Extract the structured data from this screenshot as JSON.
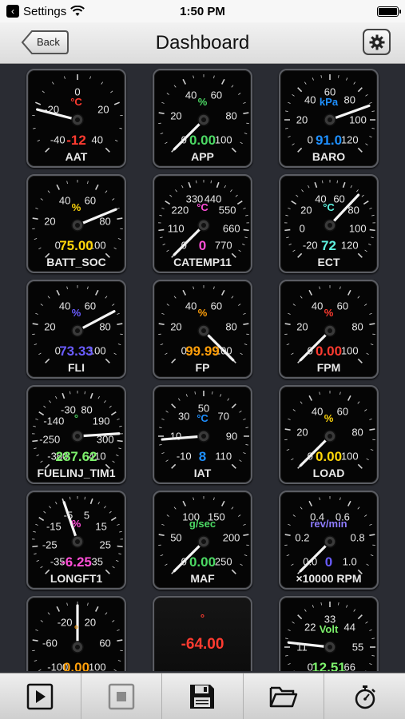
{
  "status": {
    "back_app": "Settings",
    "time": "1:50 PM"
  },
  "nav": {
    "title": "Dashboard",
    "back_label": "Back"
  },
  "gauges": [
    {
      "label": "AAT",
      "unit": "°C",
      "value": "-12",
      "color": "#ff3b30",
      "unit_color": "#ff3b30",
      "needle": 0.22,
      "ticks": [
        "-40",
        "-20",
        "0",
        "20",
        "40"
      ]
    },
    {
      "label": "APP",
      "unit": "%",
      "value": "0.00",
      "color": "#4cd964",
      "unit_color": "#4cd964",
      "needle": 0.0,
      "ticks": [
        "0",
        "20",
        "40",
        "60",
        "80",
        "100"
      ]
    },
    {
      "label": "BARO",
      "unit": "kPa",
      "value": "91.0",
      "color": "#1e90ff",
      "unit_color": "#1e90ff",
      "needle": 0.76,
      "ticks": [
        "0",
        "20",
        "40",
        "60",
        "80",
        "100",
        "120"
      ]
    },
    {
      "label": "BATT_SOC",
      "unit": "%",
      "value": "75.00",
      "color": "#ffd60a",
      "unit_color": "#ffd60a",
      "needle": 0.75,
      "ticks": [
        "0",
        "20",
        "40",
        "60",
        "80",
        "100"
      ]
    },
    {
      "label": "CATEMP11",
      "unit": "°C",
      "value": "0",
      "color": "#ff4fd8",
      "unit_color": "#ff4fd8",
      "needle": 0.0,
      "ticks": [
        "0",
        "110",
        "220",
        "330",
        "440",
        "550",
        "660",
        "770"
      ]
    },
    {
      "label": "ECT",
      "unit": "°C",
      "value": "72",
      "color": "#5ef2e0",
      "unit_color": "#5ef2e0",
      "needle": 0.66,
      "ticks": [
        "-20",
        "0",
        "20",
        "40",
        "60",
        "80",
        "100",
        "120"
      ]
    },
    {
      "label": "FLI",
      "unit": "%",
      "value": "73.33",
      "color": "#6a5cff",
      "unit_color": "#6a5cff",
      "needle": 0.73,
      "ticks": [
        "0",
        "20",
        "40",
        "60",
        "80",
        "100"
      ]
    },
    {
      "label": "FP",
      "unit": "%",
      "value": "99.99",
      "color": "#ff9f0a",
      "unit_color": "#ff9f0a",
      "needle": 1.0,
      "ticks": [
        "0",
        "20",
        "40",
        "60",
        "80",
        "100"
      ]
    },
    {
      "label": "FPM",
      "unit": "%",
      "value": "0.00",
      "color": "#ff3b30",
      "unit_color": "#ff3b30",
      "needle": 0.0,
      "ticks": [
        "0",
        "20",
        "40",
        "60",
        "80",
        "100"
      ]
    },
    {
      "label": "FUELINJ_TIM1",
      "unit": "°",
      "value": "287.62",
      "color": "#7cf06b",
      "unit_color": "#4cd964",
      "needle": 0.82,
      "ticks": [
        "-360",
        "-250",
        "-140",
        "-30",
        "80",
        "190",
        "300",
        "410"
      ]
    },
    {
      "label": "IAT",
      "unit": "°C",
      "value": "8",
      "color": "#1e90ff",
      "unit_color": "#1e90ff",
      "needle": 0.15,
      "ticks": [
        "-10",
        "10",
        "30",
        "50",
        "70",
        "90",
        "110"
      ]
    },
    {
      "label": "LOAD",
      "unit": "%",
      "value": "0.00",
      "color": "#ffd60a",
      "unit_color": "#ffd60a",
      "needle": 0.0,
      "ticks": [
        "0",
        "20",
        "40",
        "60",
        "80",
        "100"
      ]
    },
    {
      "label": "LONGFT1",
      "unit": "%",
      "value": "-6.25",
      "color": "#ff4fd8",
      "unit_color": "#ff4fd8",
      "needle": 0.43,
      "ticks": [
        "-35",
        "-25",
        "-15",
        "-5",
        "5",
        "15",
        "25",
        "35"
      ]
    },
    {
      "label": "MAF",
      "unit": "g/sec",
      "value": "0.00",
      "color": "#4cd964",
      "unit_color": "#4cd964",
      "needle": 0.0,
      "ticks": [
        "0",
        "50",
        "100",
        "150",
        "200",
        "250"
      ]
    },
    {
      "label": "×10000 RPM",
      "unit": "rev/min",
      "value": "0",
      "color": "#6a5cff",
      "unit_color": "#8e7cff",
      "needle": 0.0,
      "ticks": [
        "0.0",
        "0.2",
        "0.4",
        "0.6",
        "0.8",
        "1.0"
      ]
    },
    {
      "label": "",
      "unit": "°",
      "value": "0.00",
      "color": "#ff9f0a",
      "unit_color": "#ff9f0a",
      "needle": 0.5,
      "ticks": [
        "-100",
        "-60",
        "-20",
        "20",
        "60",
        "100"
      ]
    },
    {
      "label": "",
      "unit": "°",
      "value": "-64.00",
      "color": "#ff3b30",
      "unit_color": "#ff3b30",
      "needle": 0,
      "digital": true,
      "ticks": []
    },
    {
      "label": "",
      "unit": "Volt",
      "value": "12.51",
      "color": "#7cf06b",
      "unit_color": "#7cf06b",
      "needle": 0.19,
      "ticks": [
        "0",
        "11",
        "22",
        "33",
        "44",
        "55",
        "66"
      ]
    }
  ],
  "toolbar": [
    {
      "name": "play-button",
      "icon": "play-icon"
    },
    {
      "name": "stop-button",
      "icon": "stop-icon"
    },
    {
      "name": "save-button",
      "icon": "save-icon"
    },
    {
      "name": "open-folder-button",
      "icon": "folder-icon"
    },
    {
      "name": "stopwatch-button",
      "icon": "stopwatch-icon"
    }
  ]
}
